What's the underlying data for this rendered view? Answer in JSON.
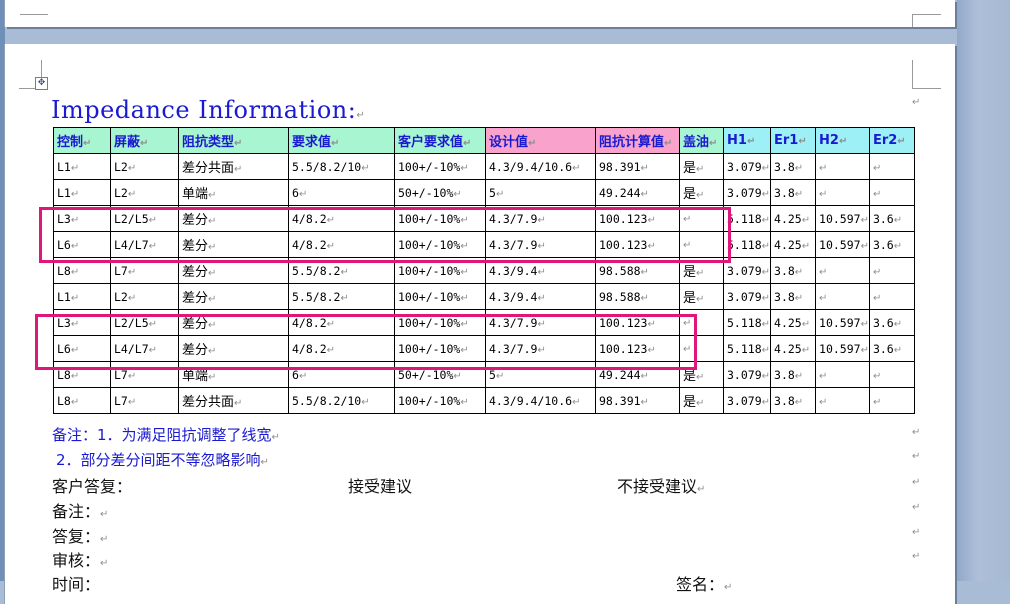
{
  "title": "Impedance Information:",
  "headers": [
    "控制",
    "屏蔽",
    "阻抗类型",
    "要求值",
    "客户要求值",
    "设计值",
    "阻抗计算值",
    "盖油",
    "H1",
    "Er1",
    "H2",
    "Er2"
  ],
  "rows": [
    [
      "L1",
      "L2",
      "差分共面",
      "5.5/8.2/10",
      "100+/-10%",
      "4.3/9.4/10.6",
      "98.391",
      "是",
      "3.079",
      "3.8",
      "",
      ""
    ],
    [
      "L1",
      "L2",
      "单端",
      "6",
      "50+/-10%",
      "5",
      "49.244",
      "是",
      "3.079",
      "3.8",
      "",
      ""
    ],
    [
      "L3",
      "L2/L5",
      "差分",
      "4/8.2",
      "100+/-10%",
      "4.3/7.9",
      "100.123",
      "",
      "5.118",
      "4.25",
      "10.597",
      "3.6"
    ],
    [
      "L6",
      "L4/L7",
      "差分",
      "4/8.2",
      "100+/-10%",
      "4.3/7.9",
      "100.123",
      "",
      "5.118",
      "4.25",
      "10.597",
      "3.6"
    ],
    [
      "L8",
      "L7",
      "差分",
      "5.5/8.2",
      "100+/-10%",
      "4.3/9.4",
      "98.588",
      "是",
      "3.079",
      "3.8",
      "",
      ""
    ],
    [
      "L1",
      "L2",
      "差分",
      "5.5/8.2",
      "100+/-10%",
      "4.3/9.4",
      "98.588",
      "是",
      "3.079",
      "3.8",
      "",
      ""
    ],
    [
      "L3",
      "L2/L5",
      "差分",
      "4/8.2",
      "100+/-10%",
      "4.3/7.9",
      "100.123",
      "",
      "5.118",
      "4.25",
      "10.597",
      "3.6"
    ],
    [
      "L6",
      "L4/L7",
      "差分",
      "4/8.2",
      "100+/-10%",
      "4.3/7.9",
      "100.123",
      "",
      "5.118",
      "4.25",
      "10.597",
      "3.6"
    ],
    [
      "L8",
      "L7",
      "单端",
      "6",
      "50+/-10%",
      "5",
      "49.244",
      "是",
      "3.079",
      "3.8",
      "",
      ""
    ],
    [
      "L8",
      "L7",
      "差分共面",
      "5.5/8.2/10",
      "100+/-10%",
      "4.3/9.4/10.6",
      "98.391",
      "是",
      "3.079",
      "3.8",
      "",
      ""
    ]
  ],
  "notes": {
    "note1": "备注：1．为满足阻抗调整了线宽",
    "note2": "2．部分差分间距不等忽略影响"
  },
  "reply": {
    "customer_reply": "客户答复：",
    "accept": "接受建议",
    "reject": "不接受建议",
    "remark": "备注：",
    "answer": "答复：",
    "review": "审核：",
    "time": "时间：",
    "signature": "签名："
  },
  "colors": {
    "header_green": "#a8f5d2",
    "header_pink": "#f8a2cc",
    "highlight_box": "#e0177a",
    "title_blue": "#1a1ad0"
  }
}
